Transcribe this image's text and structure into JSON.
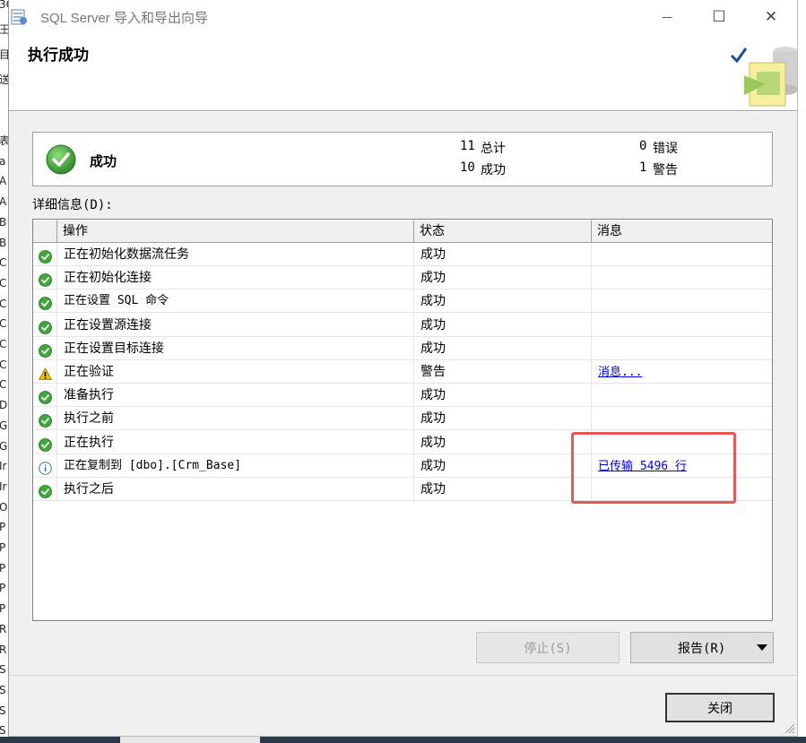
{
  "window": {
    "title": "SQL Server 导入和导出向导",
    "minimize_glyph": "—",
    "maximize_glyph": "☐",
    "close_glyph": "✕"
  },
  "header": {
    "title": "执行成功"
  },
  "summary": {
    "status": "成功",
    "total_value": "11",
    "total_label": "总计",
    "success_value": "10",
    "success_label": "成功",
    "error_value": "0",
    "error_label": "错误",
    "warning_value": "1",
    "warning_label": "警告"
  },
  "details": {
    "label": "详细信息(D):",
    "columns": [
      "操作",
      "状态",
      "消息"
    ],
    "rows": [
      {
        "icon": "success-icon",
        "action": "正在初始化数据流任务",
        "status": "成功",
        "message": ""
      },
      {
        "icon": "success-icon",
        "action": "正在初始化连接",
        "status": "成功",
        "message": ""
      },
      {
        "icon": "success-icon",
        "action": "正在设置 SQL 命令",
        "status": "成功",
        "message": ""
      },
      {
        "icon": "success-icon",
        "action": "正在设置源连接",
        "status": "成功",
        "message": ""
      },
      {
        "icon": "success-icon",
        "action": "正在设置目标连接",
        "status": "成功",
        "message": ""
      },
      {
        "icon": "warning-icon",
        "action": "正在验证",
        "status": "警告",
        "message": "消息..."
      },
      {
        "icon": "success-icon",
        "action": "准备执行",
        "status": "成功",
        "message": ""
      },
      {
        "icon": "success-icon",
        "action": "执行之前",
        "status": "成功",
        "message": ""
      },
      {
        "icon": "success-icon",
        "action": "正在执行",
        "status": "成功",
        "message": ""
      },
      {
        "icon": "info-icon",
        "action": "正在复制到 [dbo].[Crm_Base]",
        "status": "成功",
        "message": "已传输 5496 行"
      },
      {
        "icon": "success-icon",
        "action": "执行之后",
        "status": "成功",
        "message": ""
      }
    ]
  },
  "buttons": {
    "stop": "停止(S)",
    "report": "报告(R)",
    "close": "关闭"
  },
  "colors": {
    "success": "#3fa83a",
    "warning": "#f2c200",
    "info": "#3a6fb5",
    "link": "#0000ee",
    "highlight": "#e8585b"
  },
  "background_strip": [
    "3C",
    "王",
    "目",
    "送",
    "表",
    "a",
    "A",
    "A",
    "B",
    "B",
    "C",
    "C",
    "C",
    "C",
    "C",
    "C",
    "C",
    "D",
    "G",
    "G",
    "Ir",
    "Ir",
    "O",
    "P",
    "P",
    "P",
    "P",
    "P",
    "R",
    "R",
    "S",
    "S",
    "S",
    "S",
    "S"
  ]
}
